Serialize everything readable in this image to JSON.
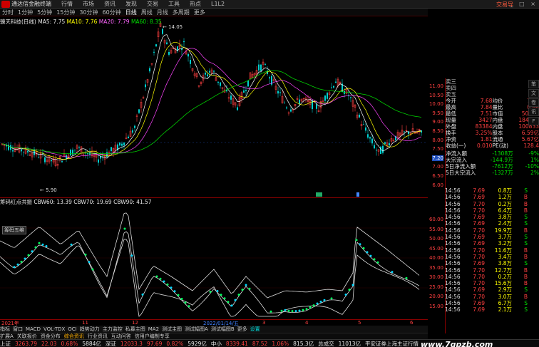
{
  "app": {
    "title": "通达信金融终端",
    "menus": [
      "行情",
      "市场",
      "资讯",
      "发现",
      "交易",
      "工具",
      "热点",
      "L1L2"
    ],
    "brand": "交易导"
  },
  "periods": [
    "分时",
    "1分钟",
    "5分钟",
    "15分钟",
    "30分钟",
    "60分钟",
    "日线",
    "周线",
    "月线",
    "多周期",
    "更多"
  ],
  "periods_active": "日线",
  "stock": {
    "name": "骥天科技(日线)",
    "ma5": "MA5: 7.75",
    "ma10": "MA10: 7.76",
    "ma20": "MA20: 7.79",
    "ma60": "MA60: 8.35"
  },
  "main_axis": [
    "11.00",
    "10.50",
    "10.00",
    "9.50",
    "9.00",
    "8.50",
    "8.00",
    "7.50",
    "7.20",
    "7.00",
    "6.50",
    "6.00"
  ],
  "price_labels": {
    "high": "14.05",
    "low": "5.90"
  },
  "orderbook_labels": [
    "卖三",
    "卖四",
    "卖五"
  ],
  "quote": [
    [
      "今开",
      "7.68",
      "均价",
      "7.69"
    ],
    [
      "最高",
      "7.84",
      "量比",
      "0.88"
    ],
    [
      "最低",
      "7.51",
      "市值",
      "50.7亿"
    ],
    [
      "现量",
      "3427",
      "内盘",
      "184217"
    ],
    [
      "外盘",
      "83384",
      "内盘",
      "100833"
    ],
    [
      "换手",
      "3.25%",
      "股本",
      "6.59亿"
    ],
    [
      "净资",
      "1.81",
      "流通",
      "5.67亿"
    ],
    [
      "收益(一)",
      "0.010",
      "PE(动)",
      "128.4"
    ]
  ],
  "flows": [
    [
      "净流入额",
      "-1308万",
      "-9%"
    ],
    [
      "大宗流入",
      "-144.9万",
      "1%"
    ],
    [
      "5日净流入额",
      "-7612万",
      "-10%"
    ],
    [
      "5日大宗流入",
      "-1327万",
      "2%"
    ]
  ],
  "ticks": [
    [
      "14:56",
      "7.69",
      "0.8万",
      "S"
    ],
    [
      "14:56",
      "7.69",
      "1.2万",
      "B"
    ],
    [
      "14:56",
      "7.70",
      "0.2万",
      "B"
    ],
    [
      "14:56",
      "7.70",
      "6.4万",
      "B"
    ],
    [
      "14:56",
      "7.69",
      "3.8万",
      "S"
    ],
    [
      "14:56",
      "7.69",
      "2.4万",
      "S"
    ],
    [
      "14:56",
      "7.70",
      "19.9万",
      "B"
    ],
    [
      "14:56",
      "7.69",
      "3.7万",
      "S"
    ],
    [
      "14:56",
      "7.69",
      "3.2万",
      "S"
    ],
    [
      "14:56",
      "7.70",
      "11.6万",
      "B"
    ],
    [
      "14:56",
      "7.70",
      "3.4万",
      "B"
    ],
    [
      "14:56",
      "7.69",
      "3.8万",
      "S"
    ],
    [
      "14:56",
      "7.70",
      "12.7万",
      "B"
    ],
    [
      "14:56",
      "7.70",
      "0.2万",
      "B"
    ],
    [
      "14:56",
      "7.70",
      "15.6万",
      "B"
    ],
    [
      "14:56",
      "7.69",
      "2.9万",
      "S"
    ],
    [
      "14:56",
      "7.70",
      "3.0万",
      "B"
    ],
    [
      "14:56",
      "7.69",
      "6.7万",
      "S"
    ],
    [
      "14:56",
      "7.69",
      "2.1万",
      "S"
    ]
  ],
  "indicator": {
    "name": "筹码红点共振",
    "cbw60": "CBW60: 13.39",
    "cbw70": "CBW70: 19.69",
    "cbw90": "CBW90: 41.57",
    "label_box": "筹码五维"
  },
  "ind_axis": [
    "60.00",
    "55.00",
    "50.00",
    "45.00",
    "40.00",
    "35.00",
    "30.00",
    "25.00",
    "20.00",
    "15.00"
  ],
  "dates": [
    "2021年",
    "11",
    "12",
    "2022/01/14/五",
    "3",
    "4",
    "5",
    "6"
  ],
  "tabs": [
    "指标",
    "窗口",
    "MACD",
    "VOL-TDX",
    "OCI",
    "趋势动力",
    "主力监控",
    "私募主图",
    "MA2",
    "测试主图",
    "测试幅图A",
    "测试幅图B",
    "更多",
    "设置"
  ],
  "tabs2": [
    "扩展A",
    "关联报价",
    "资金分布",
    "综合资讯",
    "行业资讯",
    "互动问答",
    "信用户编制专享"
  ],
  "side_tabs": [
    "笔",
    "文",
    "卷",
    "讯",
    "F"
  ],
  "status": [
    {
      "t": "上证",
      "c": "wht"
    },
    {
      "t": "3263.79",
      "c": "red"
    },
    {
      "t": "22.03",
      "c": "red"
    },
    {
      "t": "0.68%",
      "c": "red"
    },
    {
      "t": "5884亿",
      "c": "wht"
    },
    {
      "t": "深证",
      "c": "wht"
    },
    {
      "t": "12033.3",
      "c": "red"
    },
    {
      "t": "97.69",
      "c": "red"
    },
    {
      "t": "0.82%",
      "c": "red"
    },
    {
      "t": "5929亿",
      "c": "wht"
    },
    {
      "t": "中小",
      "c": "wht"
    },
    {
      "t": "8339.41",
      "c": "red"
    },
    {
      "t": "87.52",
      "c": "red"
    },
    {
      "t": "1.06%",
      "c": "red"
    },
    {
      "t": "815.3亿",
      "c": "wht"
    },
    {
      "t": "总成交",
      "c": "wht"
    },
    {
      "t": "11013亿",
      "c": "wht"
    },
    {
      "t": "平安证券上海主证行情",
      "c": "wht"
    }
  ],
  "watermark": "www.7gpzb.com",
  "colors": {
    "up": "#ff4040",
    "down": "#00d0d0",
    "ma5": "#ffffff",
    "ma10": "#ffff00",
    "ma20": "#ff44ff",
    "ma60": "#00cc00",
    "grid": "#800000"
  }
}
